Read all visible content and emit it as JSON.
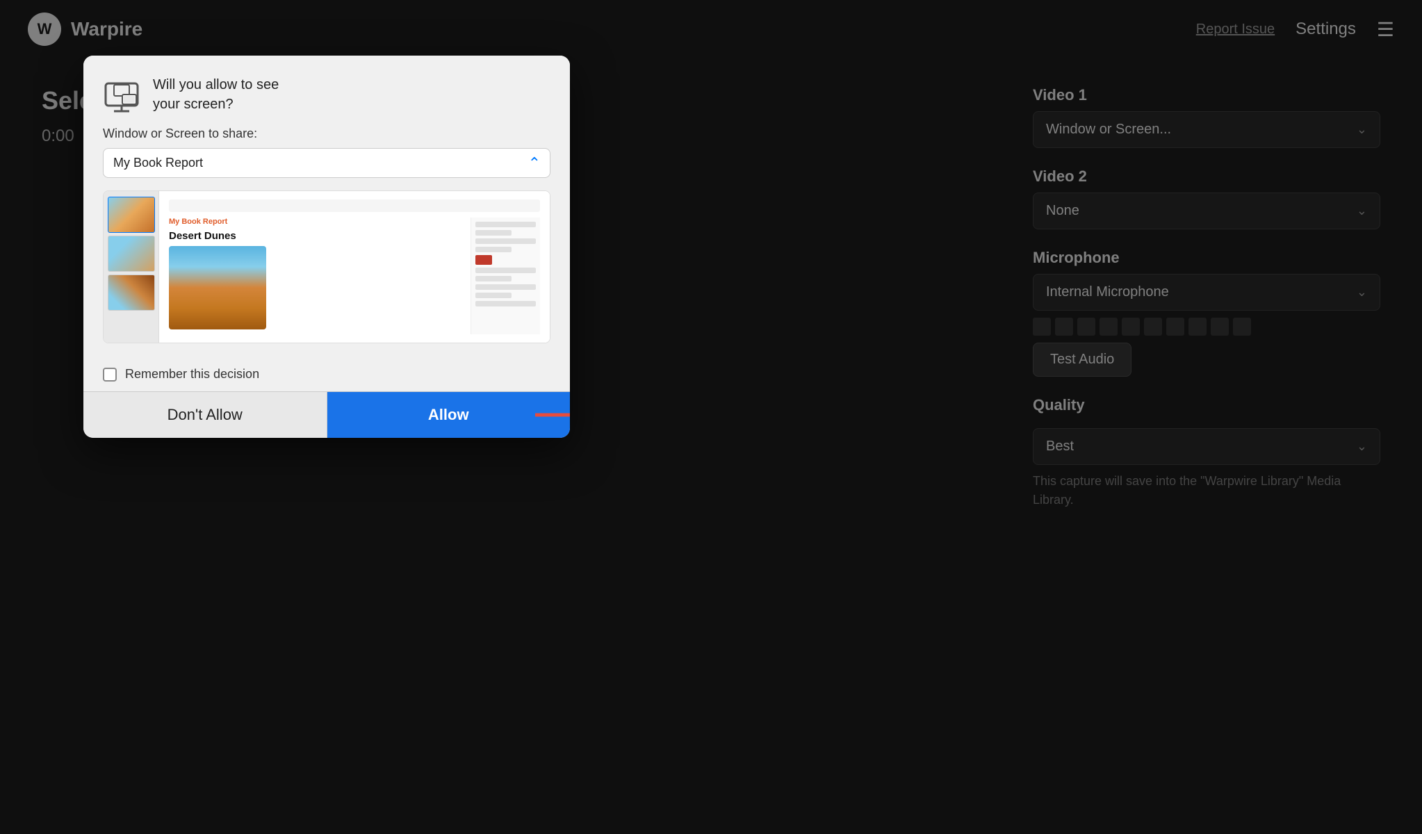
{
  "app": {
    "name": "Warpire",
    "logo_letter": "W"
  },
  "topbar": {
    "report_issue": "Report Issue",
    "settings": "Settings",
    "hamburger": "☰"
  },
  "left_panel": {
    "page_title": "Select capture sources",
    "timer": "0:00"
  },
  "right_panel": {
    "video1_label": "Video 1",
    "video1_value": "Window or Screen...",
    "video2_label": "Video 2",
    "video2_value": "None",
    "microphone_label": "Microphone",
    "microphone_value": "Internal Microphone",
    "test_audio_btn": "Test Audio",
    "quality_label": "Quality",
    "quality_value": "Best",
    "save_info": "This capture will save into the \"Warpwire Library\" Media Library."
  },
  "dialog": {
    "title_part1": "Will you allow ",
    "title_part2": "to see",
    "title_part3": "your screen?",
    "window_label": "Window or Screen to share:",
    "window_value": "My Book Report",
    "preview_doc_title": "My Book Report",
    "preview_doc_heading": "Desert Dunes",
    "checkbox_label": "Remember this decision",
    "btn_dont_allow": "Don't Allow",
    "btn_allow": "Allow"
  }
}
